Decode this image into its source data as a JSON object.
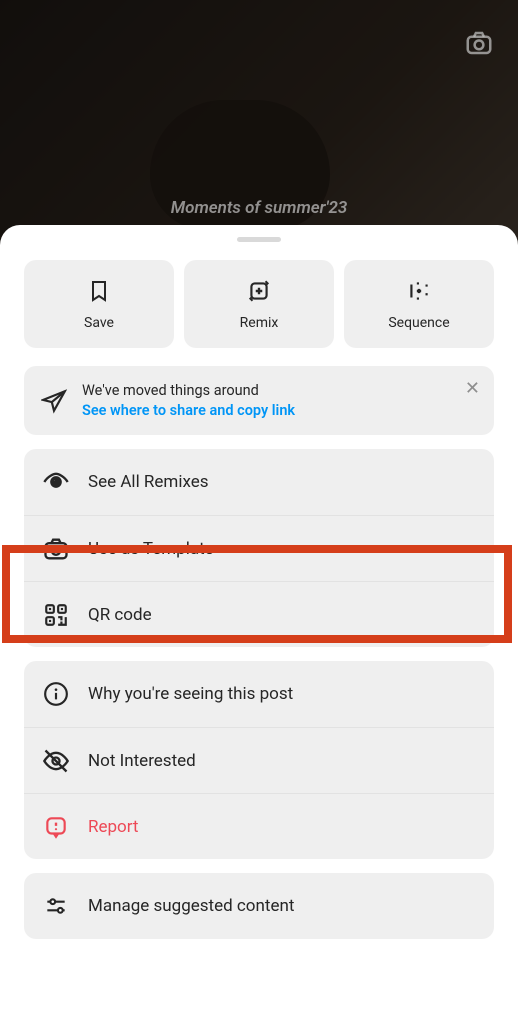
{
  "background": {
    "caption": "Moments of summer'23"
  },
  "sheet": {
    "topActions": [
      {
        "label": "Save"
      },
      {
        "label": "Remix"
      },
      {
        "label": "Sequence"
      }
    ],
    "infoBanner": {
      "title": "We've moved things around",
      "link": "See where to share and copy link"
    },
    "section1": [
      {
        "label": "See All Remixes"
      },
      {
        "label": "Use as Template"
      },
      {
        "label": "QR code"
      }
    ],
    "section2": [
      {
        "label": "Why you're seeing this post"
      },
      {
        "label": "Not Interested"
      },
      {
        "label": "Report",
        "danger": true
      }
    ],
    "section3": [
      {
        "label": "Manage suggested content"
      }
    ]
  }
}
